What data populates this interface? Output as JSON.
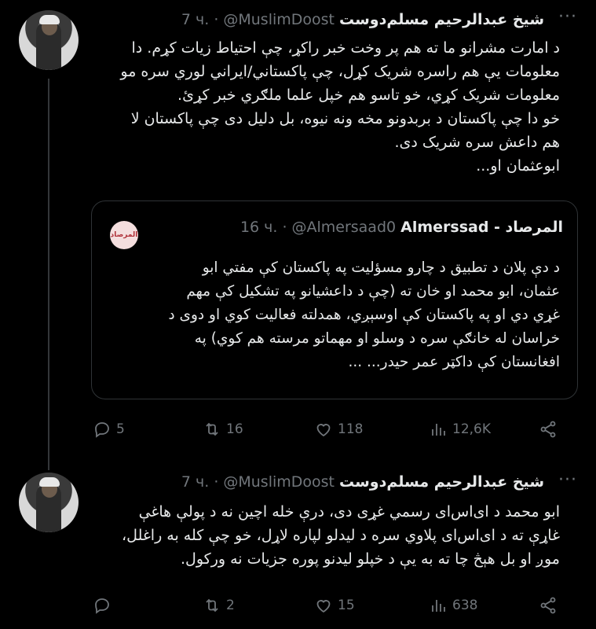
{
  "tweet1": {
    "author_name": "شيخ عبدالرحيم مسلم‌دوست",
    "handle": "@MuslimDoost",
    "separator": "·",
    "time": "7 ч.",
    "more": "···",
    "text": "د امارت مشرانو ما ته هم پر وخت خبر راکړ، چې احتیاط زیات کړم. دا\nمعلومات یې هم راسره شریک کړل، چې پاکستاني/ایراني لوري سره مو\nمعلومات شریک کړي، خو تاسو هم خپل علما ملګري خبر کړئ.\nخو دا چې پاکستان د بربدونو مخه ونه نیوه، بل دلیل دی چې پاکستان لا\nهم داعش سره شریک دی.\nابوعثمان او...",
    "quote": {
      "author_name": "Almerssad - المرصاد",
      "handle": "@Almersaad0",
      "separator": "·",
      "time": "16 ч.",
      "avatar_text": "المرصاد",
      "text": "د دې پلان د تطبیق د چارو مسؤلیت په پاکستان کې مفتي ابو\nعثمان، ابو محمد او خان ته (چې د داعشیانو په تشکیل کې مهم\nغړي دي او په پاکستان کې اوسېږي، همدلته فعالیت کوي او دوی د\nخراسان له خانګې سره د وسلو او مهماتو مرسته هم کوي) په\nافغانستان کې داکټر عمر حیدر... ..."
    },
    "actions": {
      "replies": "5",
      "reposts": "16",
      "likes": "118",
      "views": "12,6K"
    }
  },
  "tweet2": {
    "author_name": "شيخ عبدالرحيم مسلم‌دوست",
    "handle": "@MuslimDoost",
    "separator": "·",
    "time": "7 ч.",
    "more": "···",
    "text": "ابو محمد د ای‌اس‌ای رسمي غړی دی، درې خله اچین نه د پولې هاغې\nغاړې ته د ای‌اس‌ای پلاوي سره د لیدلو لپاره لاړل، خو چې کله به راغلل،\nموږ او بل هېڅ چا ته به یې د خپلو لیدنو پوره جزیات نه ورکول.",
    "actions": {
      "replies": "",
      "reposts": "2",
      "likes": "15",
      "views": "638"
    }
  }
}
